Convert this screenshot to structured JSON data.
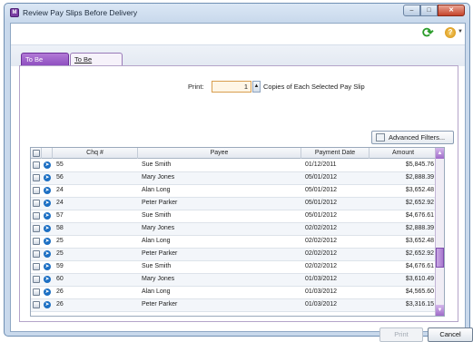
{
  "window": {
    "title": "Review Pay Slips Before Delivery",
    "app_icon": "app-icon",
    "controls": [
      "minimize-icon",
      "maximize-icon",
      "close-icon"
    ]
  },
  "toolbar": {
    "refresh_icon": "refresh-icon",
    "help_icon": "help-icon"
  },
  "tabs": [
    {
      "label": "To Be Printed",
      "active": true
    },
    {
      "label": "To Be Emailed",
      "active": false
    }
  ],
  "print": {
    "label": "Print:",
    "copies": "1",
    "suffix": "Copies of Each Selected Pay Slip"
  },
  "advanced_filters_label": "Advanced Filters...",
  "table": {
    "columns": [
      "Chq #",
      "Payee",
      "Payment Date",
      "Amount"
    ],
    "rows": [
      {
        "chq": "55",
        "payee": "Sue Smith",
        "date": "01/12/2011",
        "amount": "$5,845.76"
      },
      {
        "chq": "56",
        "payee": "Mary Jones",
        "date": "05/01/2012",
        "amount": "$2,888.39"
      },
      {
        "chq": "24",
        "payee": "Alan Long",
        "date": "05/01/2012",
        "amount": "$3,652.48"
      },
      {
        "chq": "24",
        "payee": "Peter Parker",
        "date": "05/01/2012",
        "amount": "$2,652.92"
      },
      {
        "chq": "57",
        "payee": "Sue Smith",
        "date": "05/01/2012",
        "amount": "$4,676.61"
      },
      {
        "chq": "58",
        "payee": "Mary Jones",
        "date": "02/02/2012",
        "amount": "$2,888.39"
      },
      {
        "chq": "25",
        "payee": "Alan Long",
        "date": "02/02/2012",
        "amount": "$3,652.48"
      },
      {
        "chq": "25",
        "payee": "Peter Parker",
        "date": "02/02/2012",
        "amount": "$2,652.92"
      },
      {
        "chq": "59",
        "payee": "Sue Smith",
        "date": "02/02/2012",
        "amount": "$4,676.61"
      },
      {
        "chq": "60",
        "payee": "Mary Jones",
        "date": "01/03/2012",
        "amount": "$3,610.49"
      },
      {
        "chq": "26",
        "payee": "Alan Long",
        "date": "01/03/2012",
        "amount": "$4,565.60"
      },
      {
        "chq": "26",
        "payee": "Peter Parker",
        "date": "01/03/2012",
        "amount": "$3,316.15"
      }
    ]
  },
  "footer": {
    "print_label": "Print",
    "cancel_label": "Cancel"
  },
  "colors": {
    "accent": "#8c4cbf",
    "input_highlight": "#fff6e6"
  }
}
